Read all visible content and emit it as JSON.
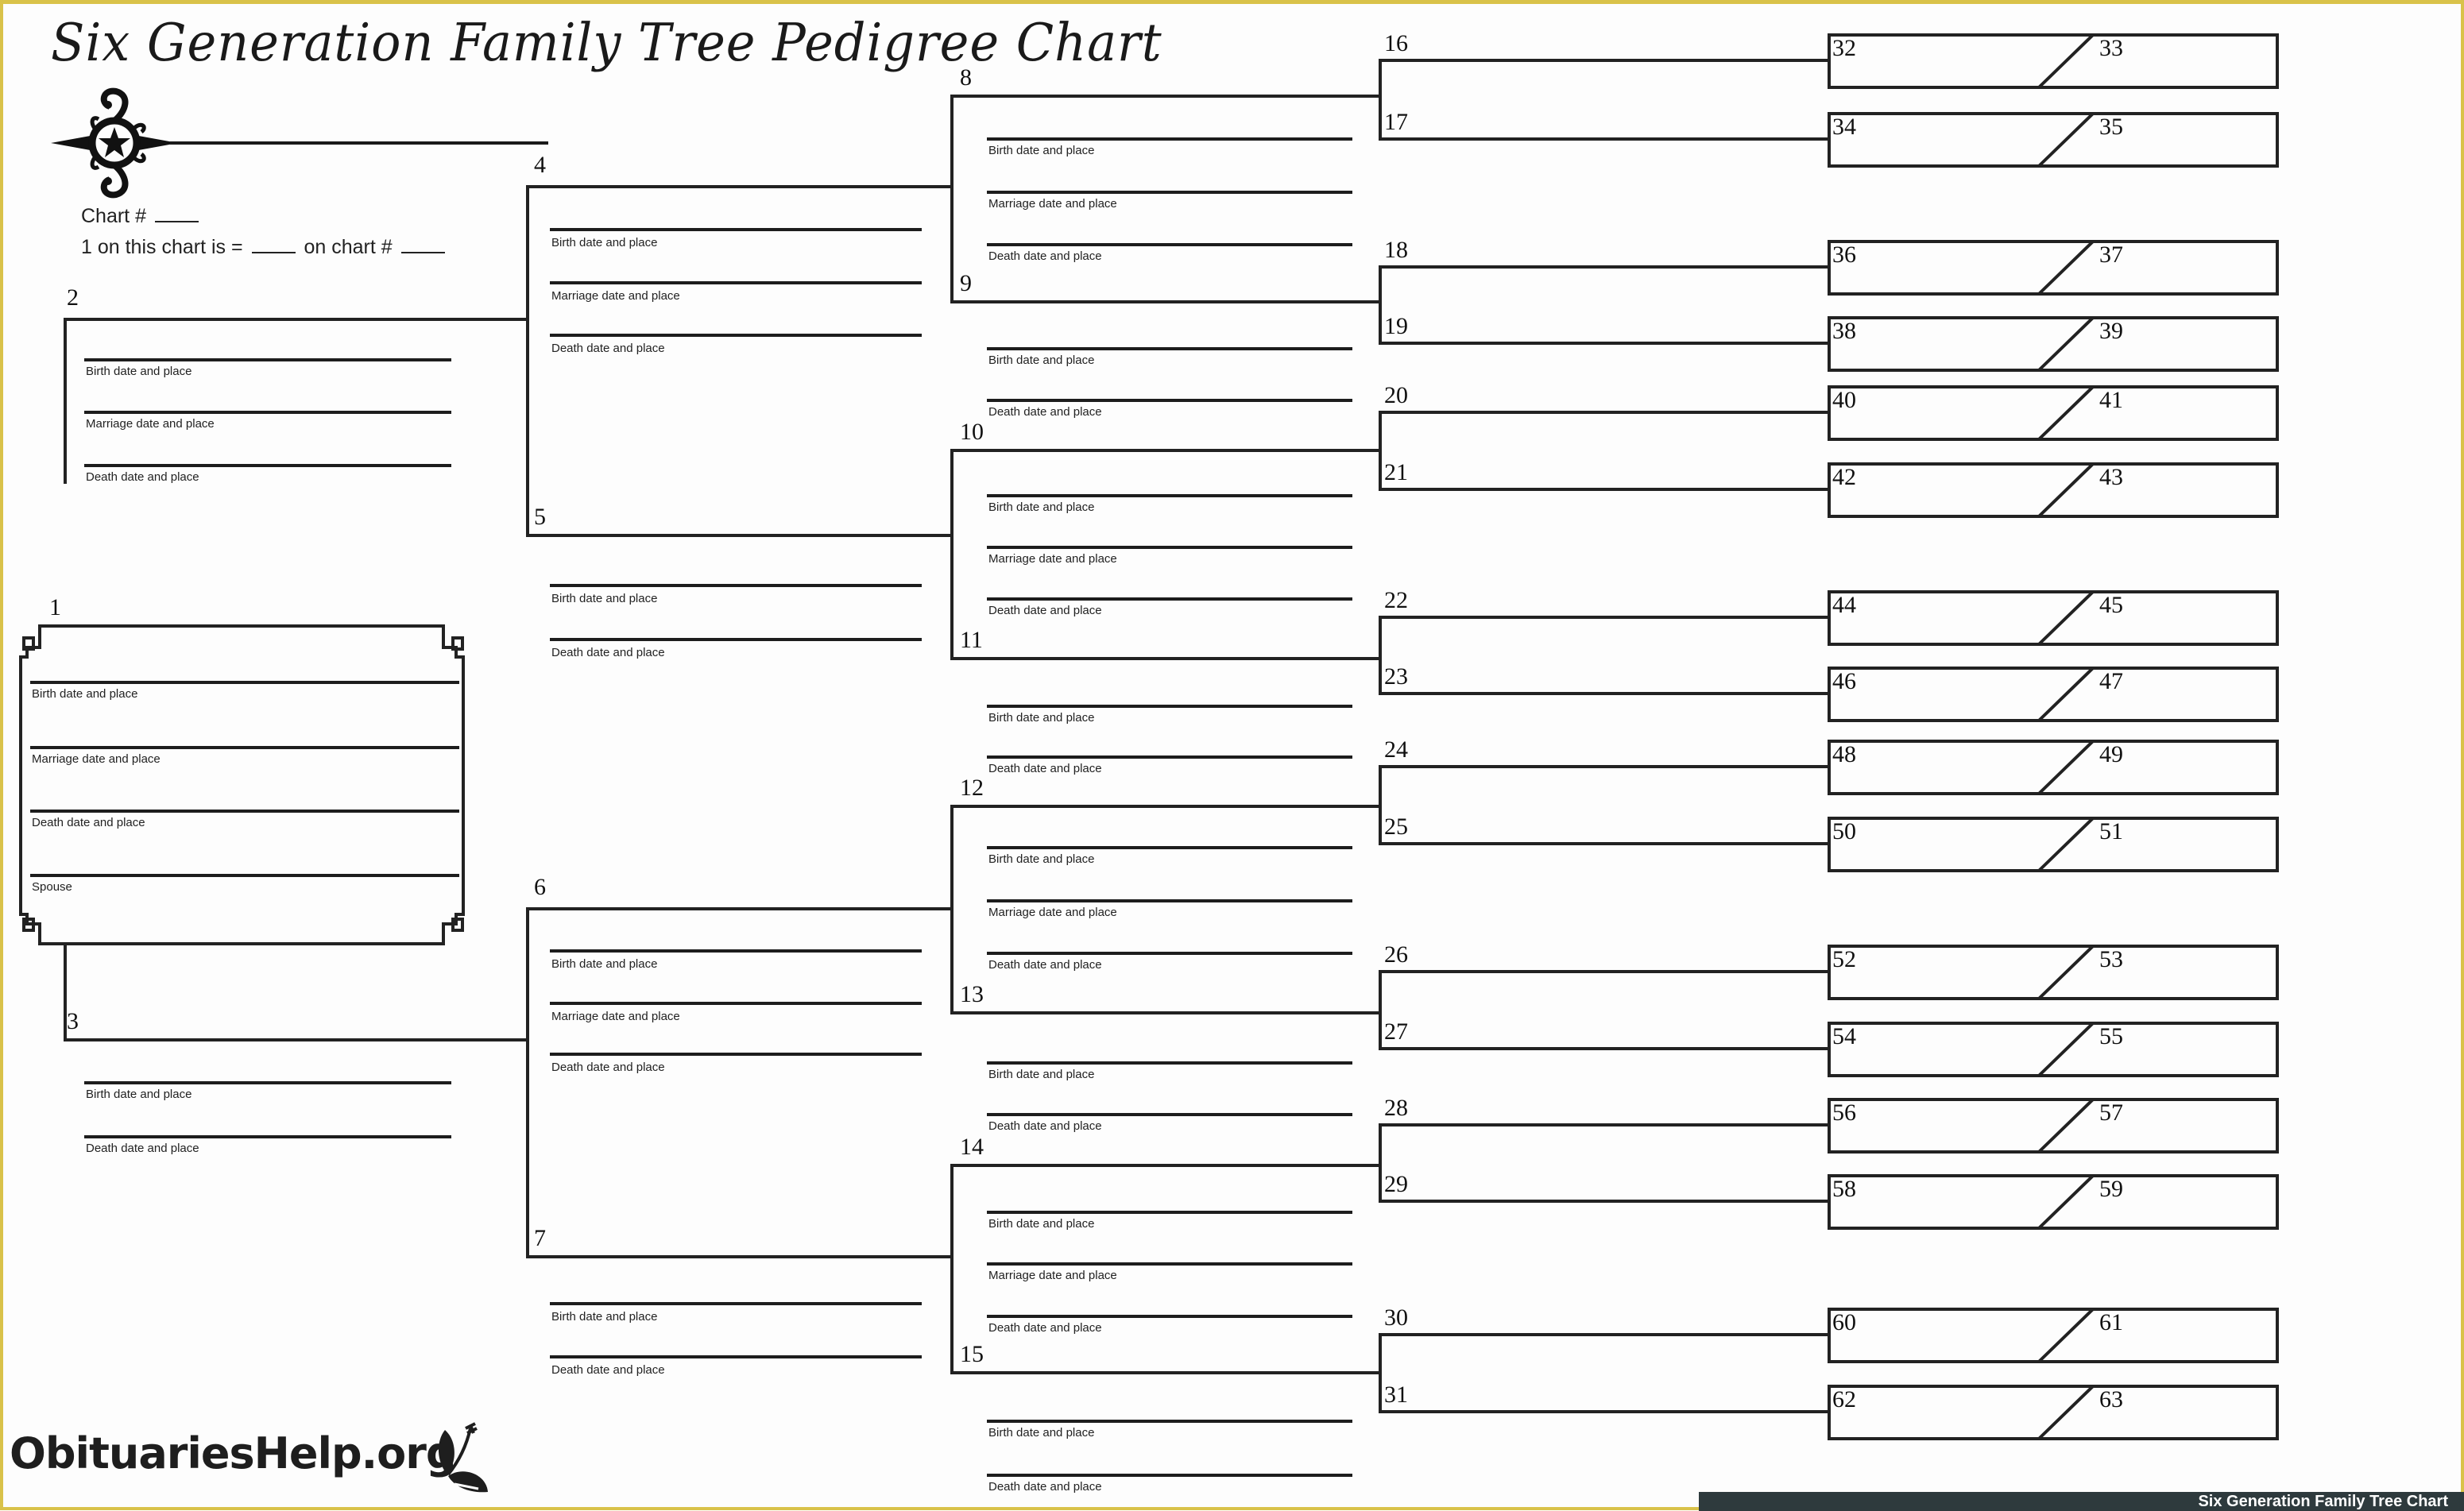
{
  "document": {
    "title": "Six Generation Family Tree Pedigree Chart",
    "chart_number_label": "Chart #",
    "chart_number_value": "",
    "reference_prefix": "1 on this chart is =",
    "reference_middle": "on chart #",
    "reference_value_1": "",
    "reference_value_2": "",
    "footer_banner": "Six Generation Family Tree Chart",
    "logo_text": "ObituariesHelp.org",
    "logo_icon": "leaf-sprout-icon",
    "ornament_icon": "star-scroll-ornament-icon"
  },
  "labels": {
    "birth": "Birth date and place",
    "marriage": "Marriage date and place",
    "death": "Death date and place",
    "spouse": "Spouse"
  },
  "generation1": {
    "number": "1",
    "fields": [
      "birth",
      "marriage",
      "death",
      "spouse"
    ]
  },
  "generation2": [
    {
      "number": "2",
      "fields": [
        "birth",
        "marriage",
        "death"
      ]
    },
    {
      "number": "3",
      "fields": [
        "birth",
        "death"
      ]
    }
  ],
  "generation3": [
    {
      "number": "4",
      "fields": [
        "birth",
        "marriage",
        "death"
      ]
    },
    {
      "number": "5",
      "fields": [
        "birth",
        "death"
      ]
    },
    {
      "number": "6",
      "fields": [
        "birth",
        "marriage",
        "death"
      ]
    },
    {
      "number": "7",
      "fields": [
        "birth",
        "death"
      ]
    }
  ],
  "generation4": [
    {
      "number": "8",
      "fields": [
        "birth",
        "marriage",
        "death"
      ]
    },
    {
      "number": "9",
      "fields": [
        "birth",
        "death"
      ]
    },
    {
      "number": "10",
      "fields": [
        "birth",
        "marriage",
        "death"
      ]
    },
    {
      "number": "11",
      "fields": [
        "birth",
        "death"
      ]
    },
    {
      "number": "12",
      "fields": [
        "birth",
        "marriage",
        "death"
      ]
    },
    {
      "number": "13",
      "fields": [
        "birth",
        "death"
      ]
    },
    {
      "number": "14",
      "fields": [
        "birth",
        "marriage",
        "death"
      ]
    },
    {
      "number": "15",
      "fields": [
        "birth",
        "death"
      ]
    }
  ],
  "generation5": [
    "16",
    "17",
    "18",
    "19",
    "20",
    "21",
    "22",
    "23",
    "24",
    "25",
    "26",
    "27",
    "28",
    "29",
    "30",
    "31"
  ],
  "generation6_pairs": [
    [
      "32",
      "33"
    ],
    [
      "34",
      "35"
    ],
    [
      "36",
      "37"
    ],
    [
      "38",
      "39"
    ],
    [
      "40",
      "41"
    ],
    [
      "42",
      "43"
    ],
    [
      "44",
      "45"
    ],
    [
      "46",
      "47"
    ],
    [
      "48",
      "49"
    ],
    [
      "50",
      "51"
    ],
    [
      "52",
      "53"
    ],
    [
      "54",
      "55"
    ],
    [
      "56",
      "57"
    ],
    [
      "58",
      "59"
    ],
    [
      "60",
      "61"
    ],
    [
      "62",
      "63"
    ]
  ],
  "colors": {
    "page_border": "#d9c24a",
    "ink": "#222222",
    "footer_bar": "#2e3a3d",
    "footer_text": "#ffffff"
  }
}
